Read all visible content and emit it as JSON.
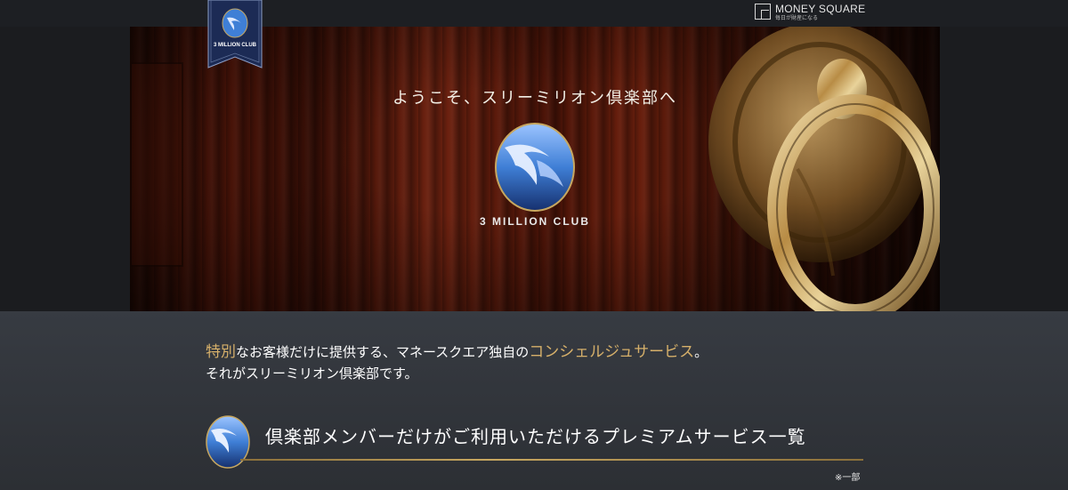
{
  "header": {
    "badge_label": "3 MILLION CLUB",
    "brand_name": "MONEY SQUARE",
    "brand_tagline": "毎日が財産になる"
  },
  "hero": {
    "title": "ようこそ、スリーミリオン倶楽部へ",
    "club_name": "3 MILLION CLUB"
  },
  "intro": {
    "line1_highlight_1": "特別",
    "line1_text_1": "なお客様だけに提供する、マネースクエア独自の",
    "line1_highlight_2": "コンシェルジュサービス",
    "line1_text_2": "。",
    "line2": "それがスリーミリオン倶楽部です。"
  },
  "section": {
    "title": "倶楽部メンバーだけがご利用いただけるプレミアムサービス一覧",
    "note": "※一部"
  },
  "colors": {
    "accent_gold": "#d6b06a",
    "rule_gold": "#c7a760",
    "emblem_blue": "#3f7fd6",
    "ribbon_navy": "#1c2b55"
  }
}
